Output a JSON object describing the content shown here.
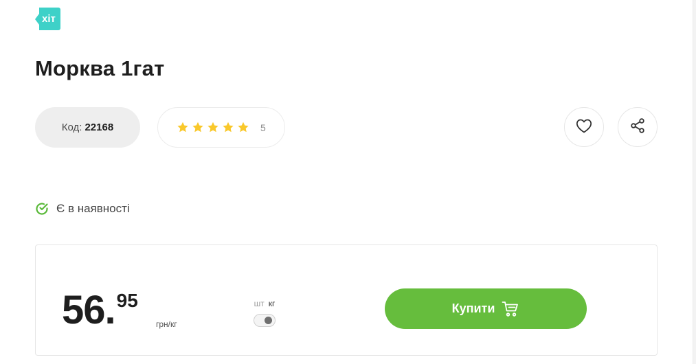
{
  "badge": {
    "label": "хіт"
  },
  "product": {
    "title": "Морква 1гат",
    "code_label": "Код:",
    "code_value": "22168",
    "rating_count": "5",
    "rating_value": 5,
    "rating_max": 5
  },
  "stock": {
    "label": "Є в наявності"
  },
  "price": {
    "integer": "56.",
    "fraction": "95",
    "unit": "грн/кг"
  },
  "unit_toggle": {
    "option_pieces": "шт",
    "option_kg": "кг",
    "selected": "кг"
  },
  "buy": {
    "label": "Купити"
  },
  "colors": {
    "badge": "#3ed1c8",
    "star": "#f9c82b",
    "stock_check": "#5ab93a",
    "buy_button": "#66bd3d"
  },
  "icons": {
    "favorite": "heart-icon",
    "share": "share-icon",
    "stock": "check-circle-icon",
    "cart": "cart-icon",
    "star": "star-icon"
  }
}
